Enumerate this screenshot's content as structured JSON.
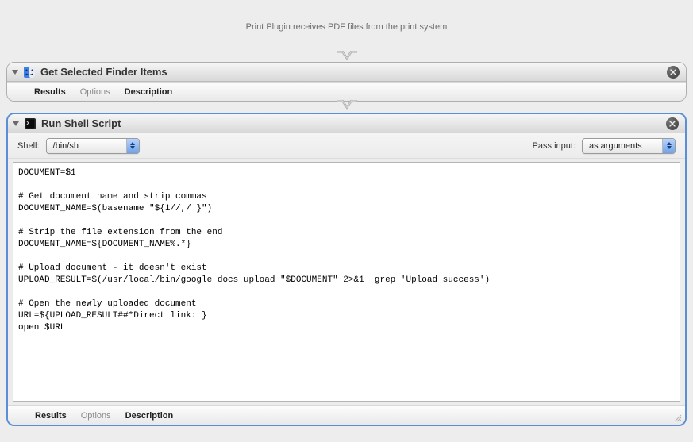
{
  "header_text": "Print Plugin receives PDF files from the print system",
  "action1": {
    "title": "Get Selected Finder Items",
    "tabs": {
      "results": "Results",
      "options": "Options",
      "description": "Description"
    }
  },
  "action2": {
    "title": "Run Shell Script",
    "shell_label": "Shell:",
    "shell_value": "/bin/sh",
    "pass_input_label": "Pass input:",
    "pass_input_value": "as arguments",
    "script": "DOCUMENT=$1\n\n# Get document name and strip commas\nDOCUMENT_NAME=$(basename \"${1//,/ }\")\n\n# Strip the file extension from the end\nDOCUMENT_NAME=${DOCUMENT_NAME%.*}\n\n# Upload document - it doesn't exist\nUPLOAD_RESULT=$(/usr/local/bin/google docs upload \"$DOCUMENT\" 2>&1 |grep 'Upload success')\n\n# Open the newly uploaded document\nURL=${UPLOAD_RESULT##*Direct link: }\nopen $URL",
    "tabs": {
      "results": "Results",
      "options": "Options",
      "description": "Description"
    }
  }
}
